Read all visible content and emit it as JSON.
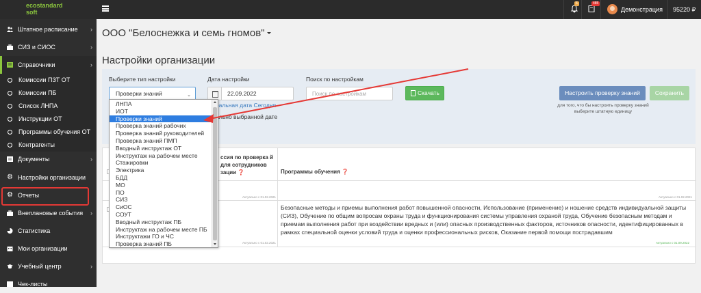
{
  "brand": {
    "line1": "ecostandard",
    "line2": "soft"
  },
  "topbar": {
    "bell_badge": "6",
    "tasks_badge": "485",
    "username": "Демонстрация",
    "balance": "95220 ₽"
  },
  "sidebar": {
    "items": [
      {
        "label": "Штатное расписание",
        "icon": "users-icon",
        "chevron": "›"
      },
      {
        "label": "СИЗ и СИОС",
        "icon": "briefcase-icon",
        "chevron": "›"
      },
      {
        "label": "Справочники",
        "icon": "book-icon",
        "chevron": "›"
      },
      {
        "label": "Документы",
        "icon": "documents-icon",
        "chevron": "›"
      },
      {
        "label": "Настройки организации",
        "icon": "gear-icon"
      },
      {
        "label": "Отчеты",
        "icon": "gear-icon"
      },
      {
        "label": "Внеплановые события",
        "icon": "briefcase-icon",
        "chevron": "›"
      },
      {
        "label": "Статистика",
        "icon": "chart-icon"
      },
      {
        "label": "Мои организации",
        "icon": "building-icon"
      },
      {
        "label": "Учебный центр",
        "icon": "graduation-icon",
        "chevron": "›"
      },
      {
        "label": "Чек-листы",
        "icon": "checklist-icon"
      }
    ],
    "subitems": [
      {
        "label": "Комиссии ПЗТ ОТ"
      },
      {
        "label": "Комиссии ПБ"
      },
      {
        "label": "Список ЛНПА"
      },
      {
        "label": "Инструкции ОТ"
      },
      {
        "label": "Программы обучения ОТ"
      },
      {
        "label": "Контрагенты"
      }
    ]
  },
  "main": {
    "org_name": "ООО \"Белоснежка и семь гномов\"",
    "page_title": "Настройки организации"
  },
  "filters": {
    "type_label": "Выберите тип настройки",
    "type_value": "Проверки знаний",
    "date_label": "Дата настройки",
    "date_value": "22.09.2022",
    "search_label": "Поиск по настройкам",
    "search_placeholder": "Поиск по настройкам",
    "download_label": "Скачать",
    "link_actual": "тральная дата",
    "link_today": "Сегодня",
    "hint": "уально выбранной дате",
    "setup_button": "Настроить проверку знаний",
    "save_button": "Сохранить",
    "note": "для того, что бы настроить проверку знаний выберите штатную единицу"
  },
  "table": {
    "col1_header": "ссия по проверка й для сотрудников зации",
    "col2_header": "Программы обучения",
    "tiny_a": "Актуально с 01.02.2021",
    "tiny_b": "Актуально с 01.02.2021",
    "tiny_c": "Актуально с 01.02.2021",
    "tiny_d": "Актуально с 01.09.2022",
    "programs_text": "Безопасные методы и приемы выполнения работ повышенной опасности, Использование (применение) и ношение средств индивидуальной защиты (СИЗ), Обучение по общим вопросам охраны труда и функционирования системы управления охраной труда, Обучение безопасным методам и приемам выполнения работ при воздействии вредных и (или) опасных производственных факторов, источников опасности, идентифицированных в рамках специальной оценки условий труда и оценки профессиональных рисков, Оказание первой помощи пострадавшим"
  },
  "dropdown_options": [
    "ЛНПА",
    "ИОТ",
    "Проверки знаний",
    "Проверка знаний рабочих",
    "Проверка знаний руководителей",
    "Проверка знаний ПМП",
    "Вводный инструктаж ОТ",
    "Инструктаж на рабочем месте",
    "Стажировки",
    "Электрика",
    "БДД",
    "МО",
    "ПО",
    "СИЗ",
    "СиОС",
    "СОУТ",
    "Вводный инструктаж ПБ",
    "Инструктаж на рабочем месте ПБ",
    "Инструктажи ГО и ЧС",
    "Проверка знаний ПБ"
  ],
  "colors": {
    "accent": "#8cc63e",
    "sidebar": "#2f2f2f",
    "selected": "#2e7de0",
    "highlight": "#e53935"
  }
}
